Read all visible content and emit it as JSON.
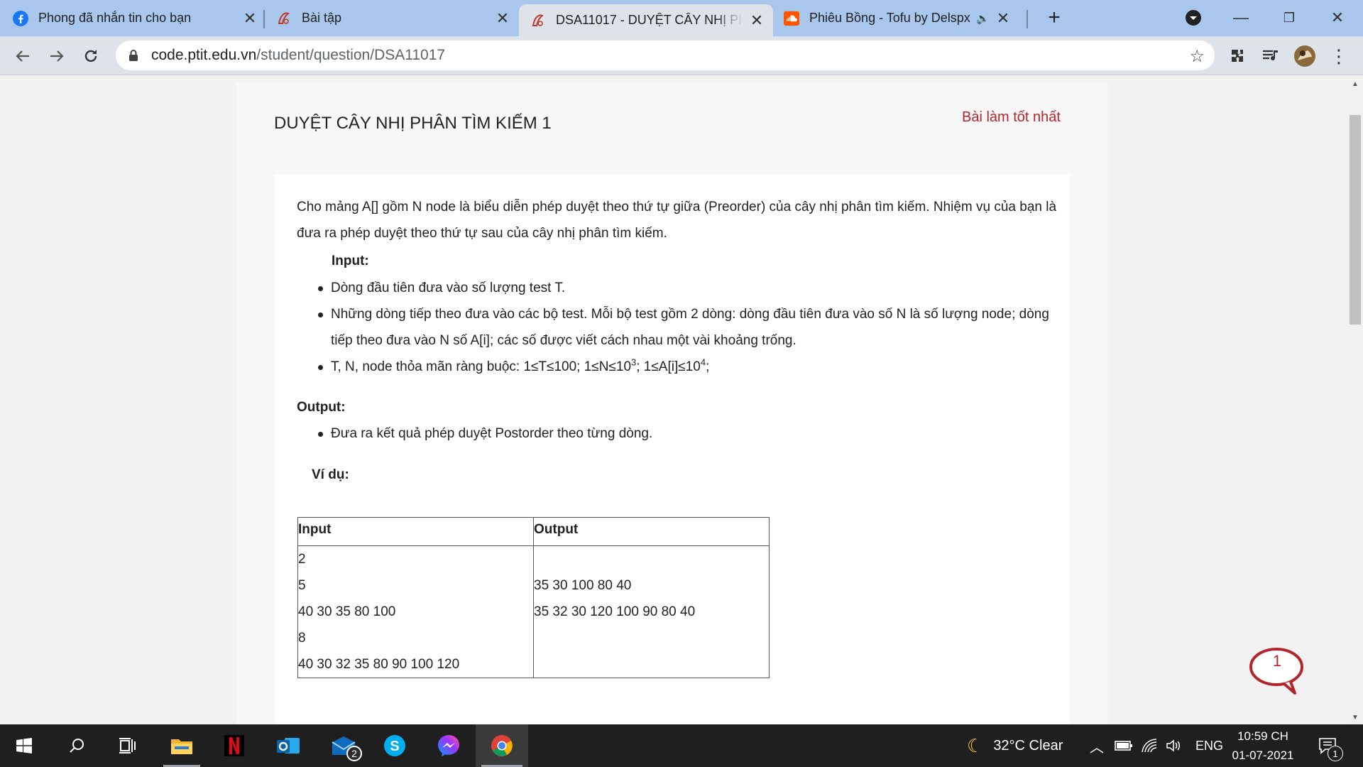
{
  "browser": {
    "tabs": [
      {
        "title": "Phong đã nhắn tin cho bạn",
        "icon": "facebook-icon"
      },
      {
        "title": "Bài tập",
        "icon": "ptit-icon"
      },
      {
        "title": "DSA11017 - DUYỆT CÂY NHỊ PHÂ",
        "icon": "ptit-icon",
        "active": true
      },
      {
        "title": "Phiêu Bồng - Tofu by Delspx",
        "icon": "soundcloud-icon",
        "audio": "speaker-icon"
      }
    ],
    "url_host": "code.ptit.edu.vn",
    "url_path": "/student/question/DSA11017"
  },
  "question": {
    "title": "DUYỆT CÂY NHỊ PHÂN TÌM KIẾM 1",
    "best_link": "Bài làm tốt nhất",
    "intro_line1": "Cho mảng A[] gồm N node là biểu diễn phép duyệt theo thứ tự giữa (Preorder) của cây nhị phân tìm kiếm. Nhiệm vụ của bạn là",
    "intro_line2": "đưa ra phép duyệt theo thứ tự sau của cây nhị phân tìm kiếm.",
    "input_heading": "Input:",
    "input_items": [
      "Dòng đầu tiên đưa vào số lượng test T.",
      "Những dòng tiếp theo đưa vào các bộ test. Mỗi bộ test gồm 2 dòng: dòng đầu tiên đưa vào số N là số lượng node; dòng",
      "tiếp theo đưa vào N số A[i]; các số được viết cách nhau một vài khoảng trống."
    ],
    "constraint_prefix": "T, N, node thỏa mãn ràng buộc: 1≤T≤100; 1≤N≤10",
    "constraint_exp1": "3",
    "constraint_mid": "; 1≤A[i]≤10",
    "constraint_exp2": "4",
    "constraint_suffix": ";",
    "output_heading": "Output:",
    "output_item": "Đưa ra kết quả phép duyệt Postorder theo từng dòng.",
    "example_heading": "Ví dụ:",
    "table": {
      "input_header": "Input",
      "output_header": "Output",
      "input_lines": [
        "2",
        "5",
        "40 30 35 80 100",
        "8",
        "40 30 32 35 80 90 100 120"
      ],
      "output_lines": [
        "",
        "35 30 100 80 40",
        "35 32 30 120 100 90 80 40",
        "",
        ""
      ]
    },
    "chat_badge": "1"
  },
  "taskbar": {
    "weather": "32°C  Clear",
    "language": "ENG",
    "time": "10:59 CH",
    "date": "01-07-2021",
    "mail_badge": "2",
    "notification_badge": "1"
  },
  "colors": {
    "tabstrip": "#a9c7ec",
    "toolbar": "#dee3ea",
    "link": "#b3262d",
    "taskbar": "#1f1f1f"
  }
}
